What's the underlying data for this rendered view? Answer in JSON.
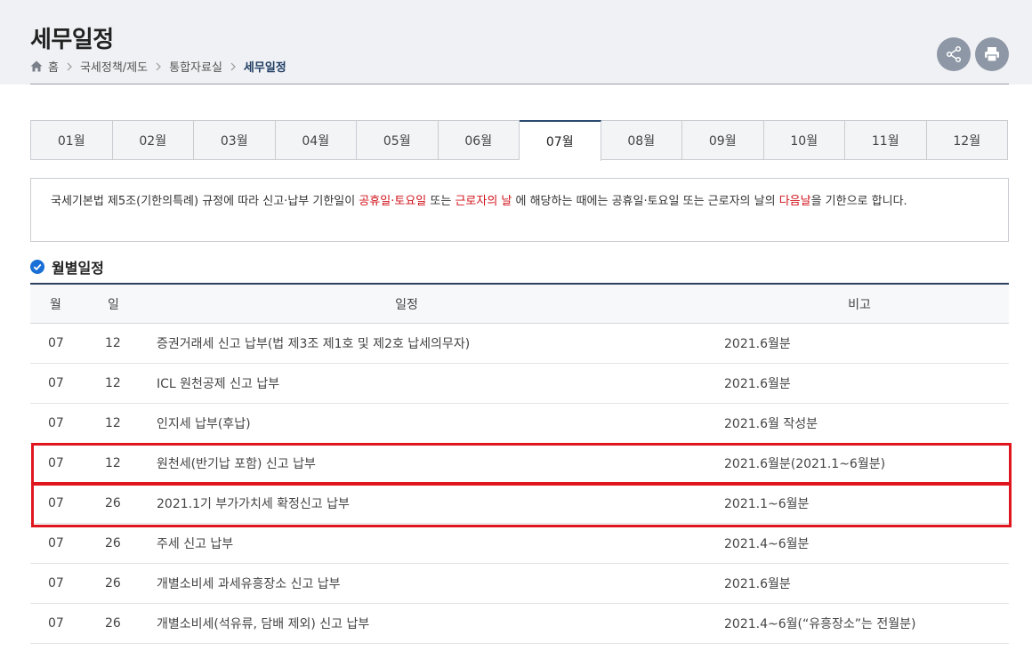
{
  "header": {
    "title": "세무일정",
    "breadcrumb": [
      "홈",
      "국세정책/제도",
      "통합자료실",
      "세무일정"
    ]
  },
  "actions": {
    "share_icon": "share-icon",
    "print_icon": "printer-icon"
  },
  "months": {
    "tabs": [
      "01월",
      "02월",
      "03월",
      "04월",
      "05월",
      "06월",
      "07월",
      "08월",
      "09월",
      "10월",
      "11월",
      "12월"
    ],
    "active": "07월"
  },
  "notice": {
    "part1": "국세기본법 제5조(기한의특례) 규정에 따라 신고·납부 기한일이 ",
    "red1": "공휴일·토요일",
    "part2": " 또는 ",
    "red2": "근로자의 날",
    "part3": " 에 해당하는 때에는 공휴일·토요일 또는 근로자의 날의 ",
    "red3": "다음날",
    "part4": "을 기한으로 합니다."
  },
  "section": {
    "title": "월별일정"
  },
  "table": {
    "headers": {
      "month": "월",
      "day": "일",
      "event": "일정",
      "note": "비고"
    },
    "rows": [
      {
        "month": "07",
        "day": "12",
        "event": "증권거래세 신고 납부(법 제3조 제1호 및 제2호 납세의무자)",
        "note": "2021.6월분"
      },
      {
        "month": "07",
        "day": "12",
        "event": "ICL 원천공제 신고 납부",
        "note": "2021.6월분"
      },
      {
        "month": "07",
        "day": "12",
        "event": "인지세 납부(후납)",
        "note": "2021.6월 작성분"
      },
      {
        "month": "07",
        "day": "12",
        "event": "원천세(반기납 포함) 신고 납부",
        "note": "2021.6월분(2021.1~6월분)"
      },
      {
        "month": "07",
        "day": "26",
        "event": "2021.1기 부가가치세 확정신고 납부",
        "note": "2021.1~6월분"
      },
      {
        "month": "07",
        "day": "26",
        "event": "주세 신고 납부",
        "note": "2021.4~6월분"
      },
      {
        "month": "07",
        "day": "26",
        "event": "개별소비세 과세유흥장소 신고 납부",
        "note": "2021.6월분"
      },
      {
        "month": "07",
        "day": "26",
        "event": "개별소비세(석유류, 담배 제외) 신고 납부",
        "note": "2021.4~6월(“유흥장소”는 전월분)"
      }
    ]
  },
  "colors": {
    "accent_red": "#e0161e",
    "navy": "#1f3d63",
    "check_blue": "#1a6fd6"
  }
}
